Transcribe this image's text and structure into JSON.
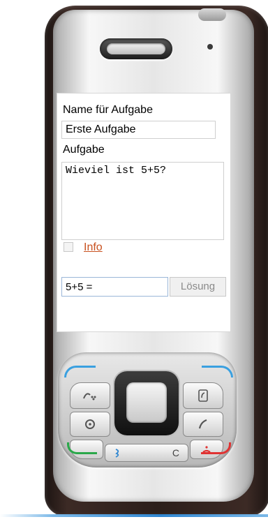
{
  "form": {
    "name_label": "Name für Aufgabe",
    "name_value": "Erste Aufgabe",
    "task_label": "Aufgabe",
    "task_value": "Wieviel ist 5+5?",
    "info_label": "Info",
    "info_checked": false,
    "answer_value": "5+5 =",
    "solve_label": "Lösung"
  },
  "keypad": {
    "clear_key": "C"
  },
  "colors": {
    "softkey_accent": "#3aa0e0",
    "call_accent": "#2aa84a",
    "end_accent": "#e03232",
    "link_color": "#c8501e"
  },
  "icons": [
    "menu-icon",
    "contacts-icon",
    "navigation-icon",
    "call-icon",
    "end-call-icon",
    "voice-icon"
  ]
}
